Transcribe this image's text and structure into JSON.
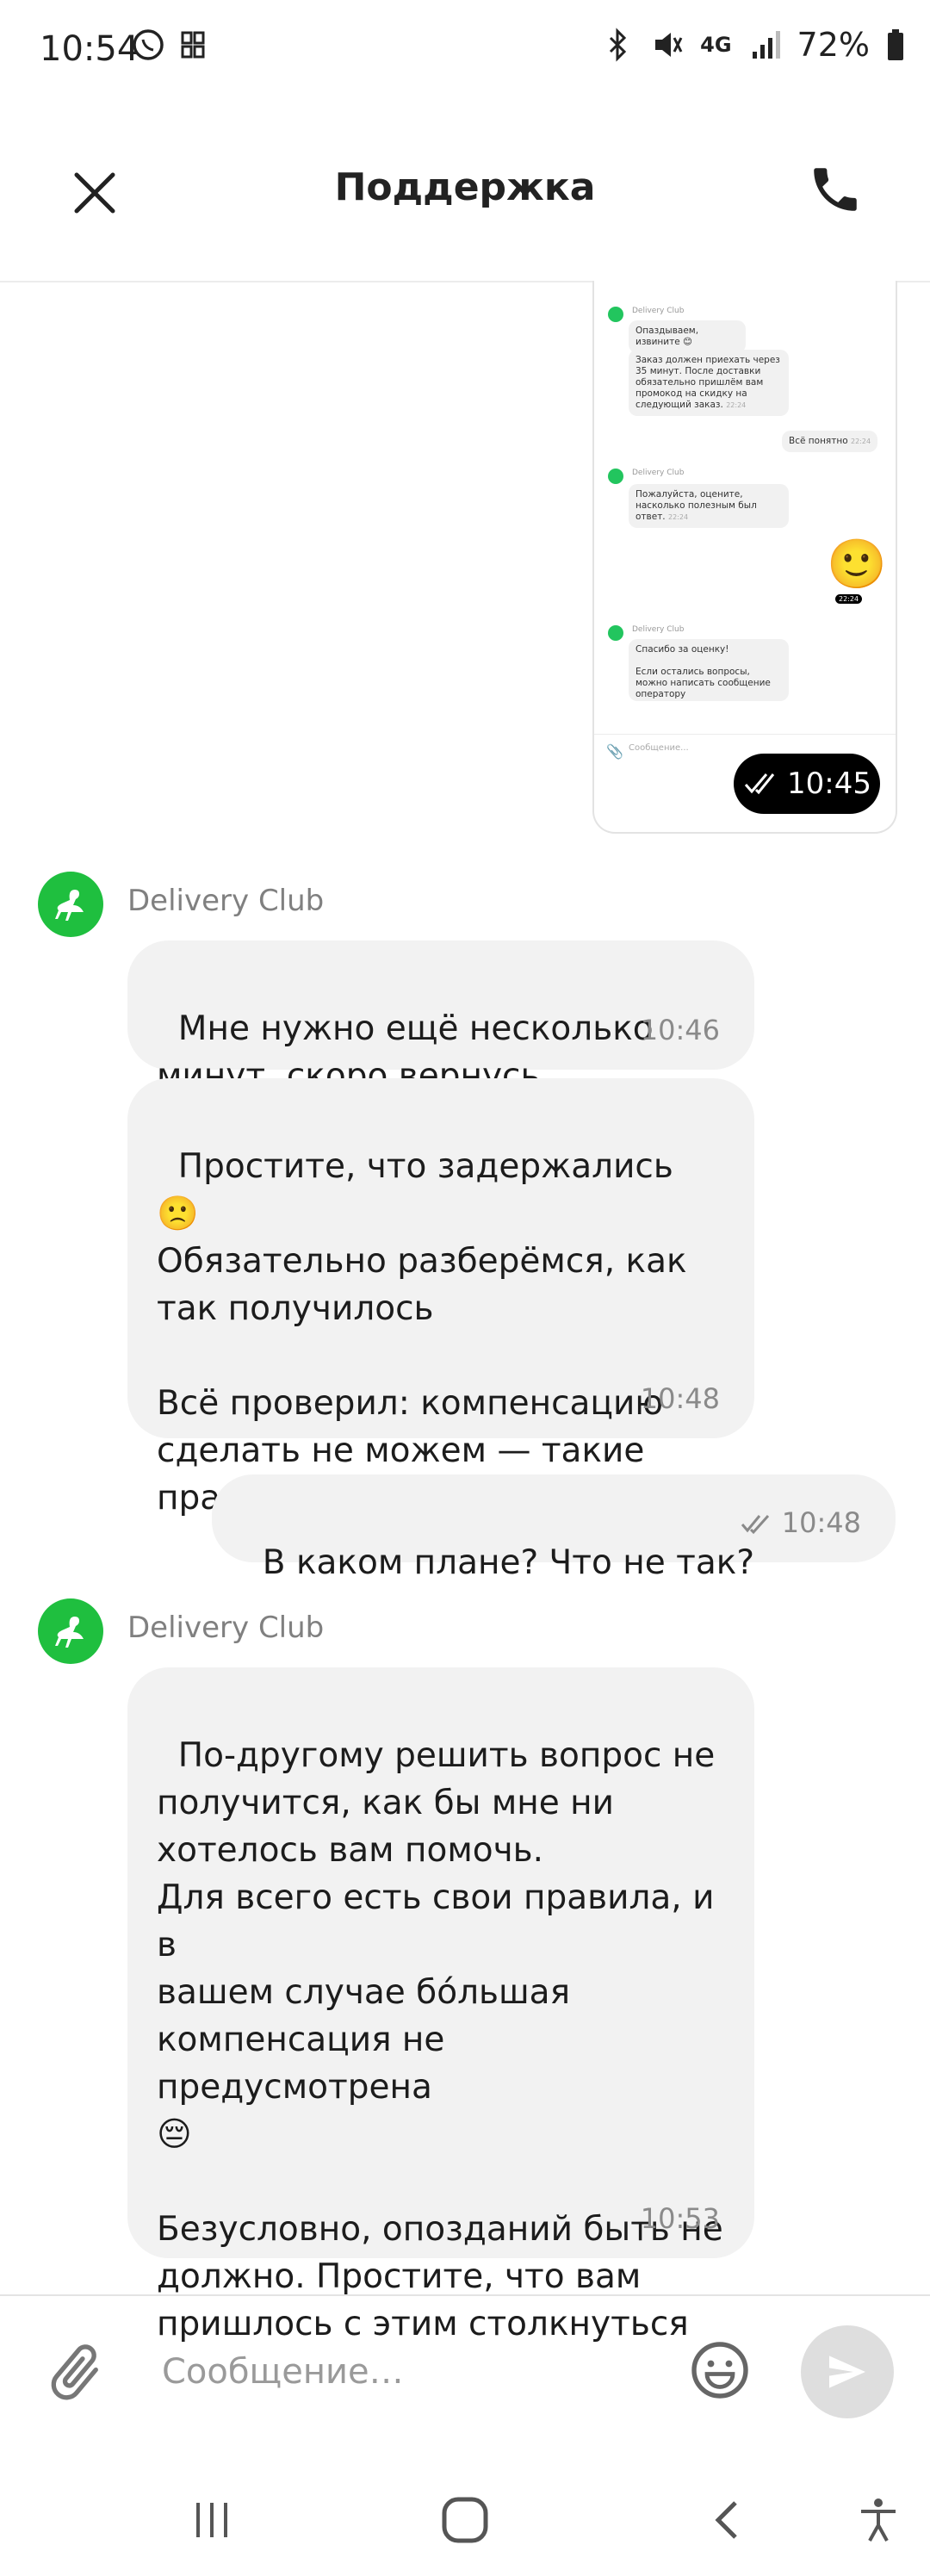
{
  "status_bar": {
    "time": "10:54",
    "network": "4G",
    "battery": "72%",
    "icons": [
      "viber-icon",
      "sim-icon",
      "bluetooth-icon",
      "mute-vibrate-icon",
      "signal-icon",
      "battery-icon"
    ]
  },
  "header": {
    "title": "Поддержка",
    "close_icon": "close-icon",
    "call_icon": "phone-icon"
  },
  "screenshot_attachment": {
    "lines": [
      {
        "sender": "Delivery Club",
        "text": "Опаздываем, извините 😊"
      },
      {
        "text": "Заказ должен приехать через 35 минут. После доставки обязательно пришлём вам промокод на скидку на следующий заказ.",
        "time": "22:24"
      },
      {
        "out": true,
        "text": "Всё понятно",
        "time": "22:24"
      },
      {
        "sender": "Delivery Club",
        "text": "Пожалуйста, оцените, насколько полезным был ответ.",
        "time": "22:24"
      },
      {
        "out": true,
        "emoji": "🙂",
        "time": "22:24"
      },
      {
        "sender": "Delivery Club",
        "text": "Спасибо за оценку!"
      },
      {
        "text": "Если остались вопросы, можно написать сообщение оператору"
      }
    ],
    "input_placeholder": "Сообщение...",
    "sent_time": "10:45"
  },
  "messages": [
    {
      "sender": "Delivery Club",
      "bubbles": [
        {
          "text": "Мне нужно ещё несколько\nминут, скоро вернусь",
          "time": "10:46"
        },
        {
          "text": "Простите, что задержались 🙁\nОбязательно разберёмся, как\nтак получилось\n\nВсё проверил: компенсацию\nсделать не можем — такие\nправила 🙁",
          "time": "10:48"
        }
      ]
    },
    {
      "outgoing": true,
      "text": "В каком плане? Что не так?",
      "time": "10:48"
    },
    {
      "sender": "Delivery Club",
      "bubbles": [
        {
          "text": "По-другому решить вопрос не\nполучится, как бы мне ни\nхотелось вам помочь.\nДля всего есть свои правила, и в\nвашем случае бóльшая\nкомпенсация не предусмотрена\n😔\n\nБезусловно, опозданий быть не\nдолжно. Простите, что вам\nпришлось с этим столкнуться",
          "time": "10:53"
        }
      ]
    }
  ],
  "composer": {
    "placeholder": "Сообщение…",
    "attach_icon": "paperclip-icon",
    "emoji_icon": "emoji-icon",
    "send_icon": "send-icon"
  },
  "colors": {
    "brand_green": "#1fbf3f",
    "bubble_bg": "#f2f2f2",
    "send_disabled": "#dedede"
  }
}
